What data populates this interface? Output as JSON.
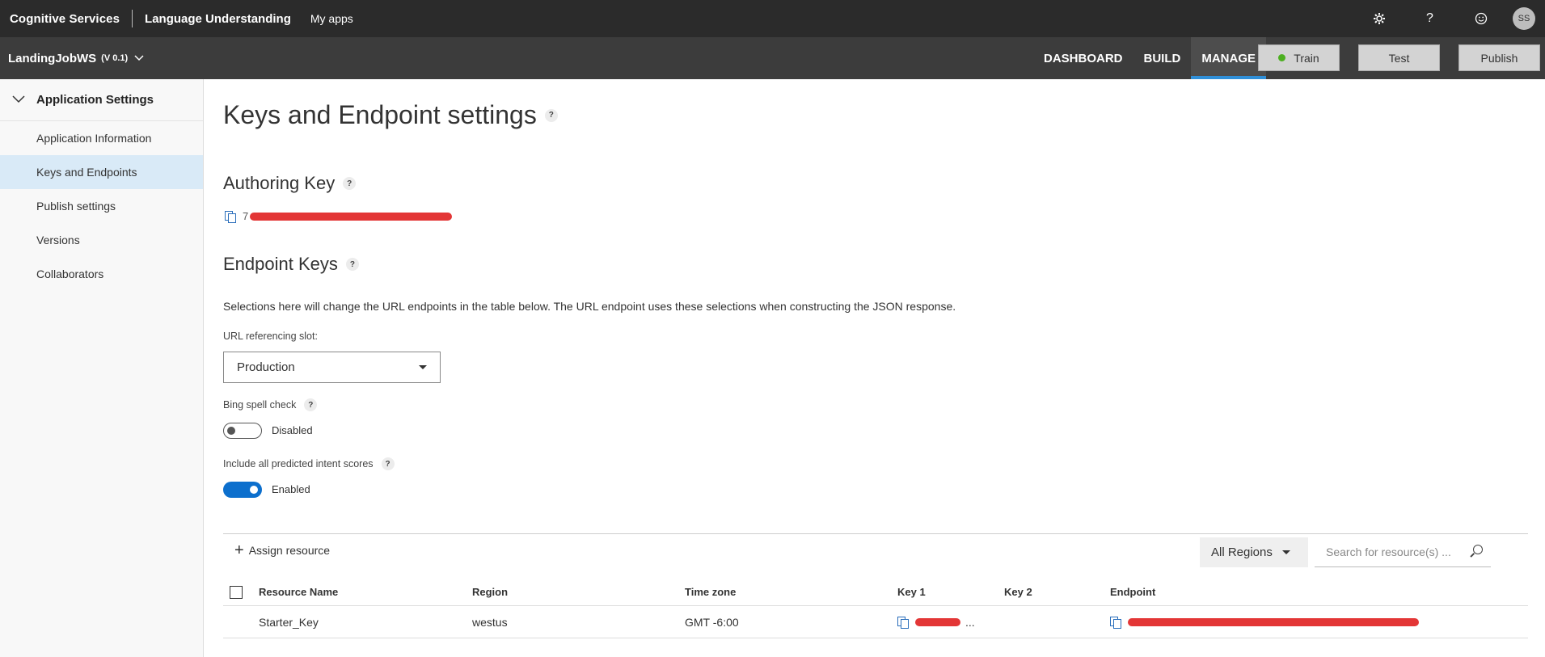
{
  "topbar": {
    "brand": "Cognitive Services",
    "product": "Language Understanding",
    "my_apps": "My apps",
    "icons": [
      "gear-icon",
      "help-icon",
      "smiley-icon"
    ],
    "help_glyph": "?",
    "avatar_initials": "SS"
  },
  "appbar": {
    "app_name": "LandingJobWS",
    "version": "(V 0.1)",
    "tabs": [
      {
        "label": "DASHBOARD",
        "active": false
      },
      {
        "label": "BUILD",
        "active": false
      },
      {
        "label": "MANAGE",
        "active": true
      }
    ],
    "train_label": "Train",
    "test_label": "Test",
    "publish_label": "Publish",
    "train_status_color": "#4caf20",
    "accent_color": "#2f8fd8"
  },
  "sidebar": {
    "section_label": "Application Settings",
    "items": [
      {
        "label": "Application Information",
        "active": false
      },
      {
        "label": "Keys and Endpoints",
        "active": true
      },
      {
        "label": "Publish settings",
        "active": false
      },
      {
        "label": "Versions",
        "active": false
      },
      {
        "label": "Collaborators",
        "active": false
      }
    ]
  },
  "main": {
    "title": "Keys and Endpoint settings",
    "help_glyph": "?",
    "authoring_key": {
      "heading": "Authoring Key",
      "value_visible_start": "7"
    },
    "endpoint_keys": {
      "heading": "Endpoint Keys",
      "description": "Selections here will change the URL endpoints in the table below. The URL endpoint uses these selections when constructing the JSON response.",
      "slot_label": "URL referencing slot:",
      "slot_value": "Production",
      "bing_label": "Bing spell check",
      "bing_state": "Disabled",
      "intent_label": "Include all predicted intent scores",
      "intent_state": "Enabled"
    },
    "resources": {
      "assign_label": "Assign resource",
      "regions_value": "All Regions",
      "search_placeholder": "Search for resource(s) ...",
      "columns": [
        "Resource Name",
        "Region",
        "Time zone",
        "Key 1",
        "Key 2",
        "Endpoint"
      ],
      "rows": [
        {
          "name": "Starter_Key",
          "region": "westus",
          "timezone": "GMT -6:00",
          "key1_suffix": "...",
          "key2": "",
          "endpoint": ""
        }
      ]
    }
  }
}
